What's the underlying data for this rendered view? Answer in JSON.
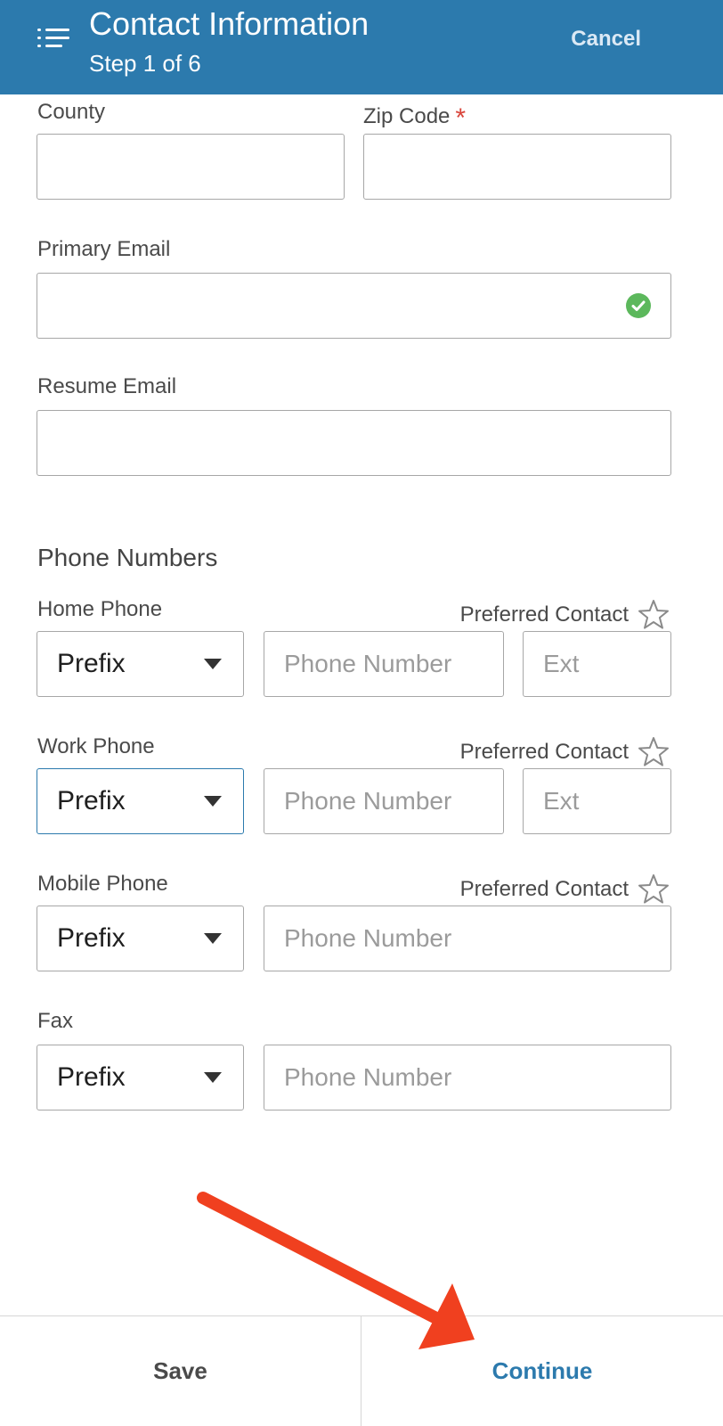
{
  "colors": {
    "accent": "#2c7aad",
    "annotation_arrow": "#f0401f",
    "valid": "#5cb85c",
    "required": "#d9453b"
  },
  "header": {
    "title": "Contact Information",
    "step": "Step 1 of 6",
    "cancel_label": "Cancel",
    "menu_icon": "list-menu-icon"
  },
  "address": {
    "county_label": "County",
    "county_value": "",
    "zip_label": "Zip Code",
    "zip_required_mark": "*",
    "zip_value": ""
  },
  "email": {
    "primary_label": "Primary Email",
    "primary_value": "",
    "primary_status_icon": "check-circle-icon",
    "resume_label": "Resume Email",
    "resume_value": ""
  },
  "phones": {
    "section_title": "Phone Numbers",
    "preferred_label": "Preferred Contact",
    "home": {
      "label": "Home Phone",
      "prefix": "Prefix",
      "number_placeholder": "Phone Number",
      "ext_placeholder": "Ext"
    },
    "work": {
      "label": "Work Phone",
      "prefix": "Prefix",
      "number_placeholder": "Phone Number",
      "ext_placeholder": "Ext"
    },
    "mobile": {
      "label": "Mobile Phone",
      "prefix": "Prefix",
      "number_placeholder": "Phone Number"
    },
    "fax": {
      "label": "Fax",
      "prefix": "Prefix",
      "number_placeholder": "Phone Number"
    }
  },
  "footer": {
    "save_label": "Save",
    "continue_label": "Continue"
  }
}
